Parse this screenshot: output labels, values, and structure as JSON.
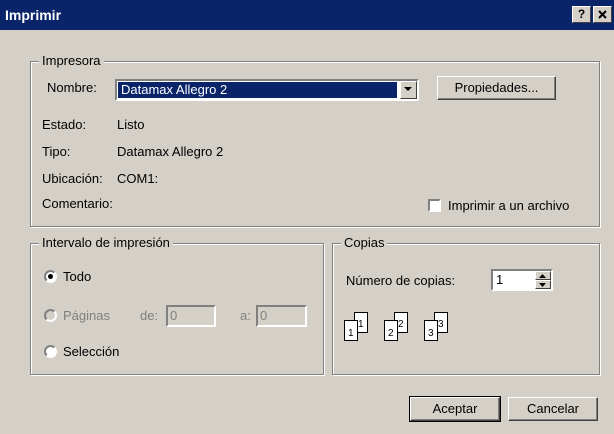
{
  "window": {
    "title": "Imprimir",
    "help_label": "?",
    "close_label": "✕"
  },
  "printer": {
    "legend": "Impresora",
    "name_label": "Nombre:",
    "name_value": "Datamax Allegro 2",
    "properties_label": "Propiedades...",
    "status_label": "Estado:",
    "status_value": "Listo",
    "type_label": "Tipo:",
    "type_value": "Datamax Allegro 2",
    "location_label": "Ubicación:",
    "location_value": "COM1:",
    "comment_label": "Comentario:",
    "print_to_file_label": "Imprimir a un archivo",
    "print_to_file_checked": false
  },
  "range": {
    "legend": "Intervalo de impresión",
    "all_label": "Todo",
    "pages_label": "Páginas",
    "from_label": "de:",
    "from_value": "0",
    "to_label": "a:",
    "to_value": "0",
    "selection_label": "Selección",
    "selected": "all"
  },
  "copies": {
    "legend": "Copias",
    "count_label": "Número de copias:",
    "count_value": "1",
    "collate_pages": [
      "1",
      "1",
      "2",
      "2",
      "3",
      "3"
    ]
  },
  "buttons": {
    "ok_label": "Aceptar",
    "cancel_label": "Cancelar"
  },
  "colors": {
    "titlebar": "#0a246a",
    "face": "#d4d0c8"
  }
}
